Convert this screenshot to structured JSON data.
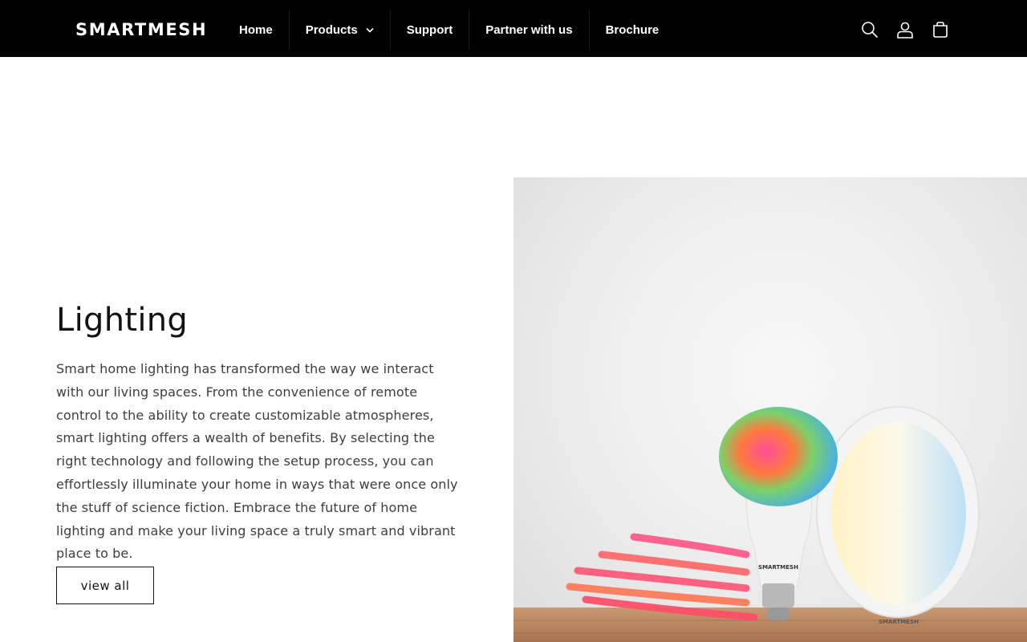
{
  "brand": {
    "name": "SMARTMESH"
  },
  "nav": {
    "items": [
      {
        "label": "Home"
      },
      {
        "label": "Products"
      },
      {
        "label": "Support"
      },
      {
        "label": "Partner with us"
      },
      {
        "label": "Brochure"
      }
    ]
  },
  "header_icons": [
    "search-icon",
    "account-icon",
    "cart-icon"
  ],
  "section": {
    "title": "Lighting",
    "description": "Smart home lighting has transformed the way we interact with our living spaces. From the convenience of remote control to the ability to create customizable atmospheres, smart lighting offers a wealth of benefits. By selecting the right technology and following the setup process, you can effortlessly illuminate your home in ways that were once only the stuff of science fiction. Embrace the future of home lighting and make your living space a truly smart and vibrant place to be.",
    "button_label": "view all"
  },
  "product_image": {
    "bulb_logo": "SMARTMESH",
    "panel_logo": "SMARTMESH"
  },
  "colors": {
    "header_bg": "#000000",
    "text": "#121212",
    "body_text": "#3d3d3d"
  }
}
